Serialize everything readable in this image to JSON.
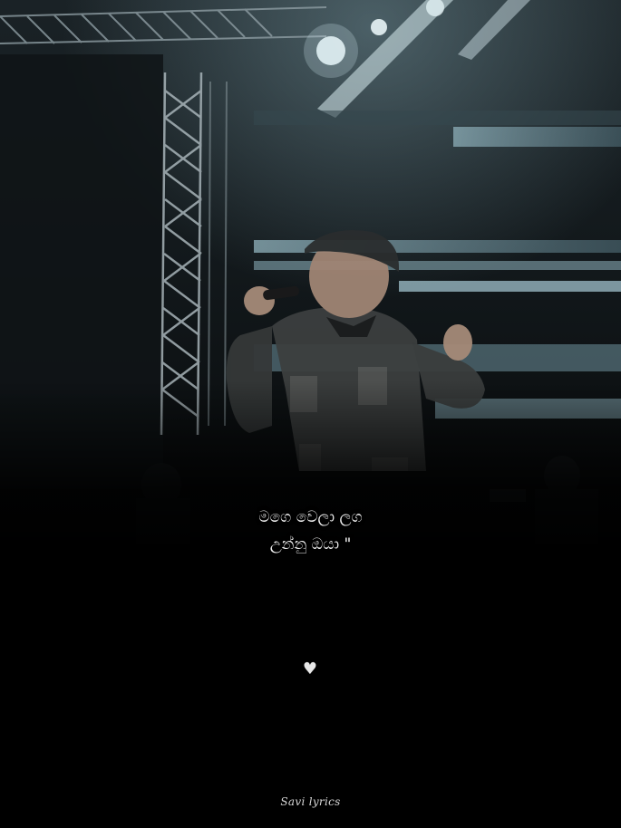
{
  "lyrics": {
    "line1": "මගෙ වෙලා ලග",
    "line2": "උන්නු ඔයා \""
  },
  "heart_icon": "heart-icon",
  "credit": "Savi lyrics",
  "colors": {
    "background": "#000000",
    "text": "#f2f2f2",
    "stage_light": "#cfe6ee"
  }
}
